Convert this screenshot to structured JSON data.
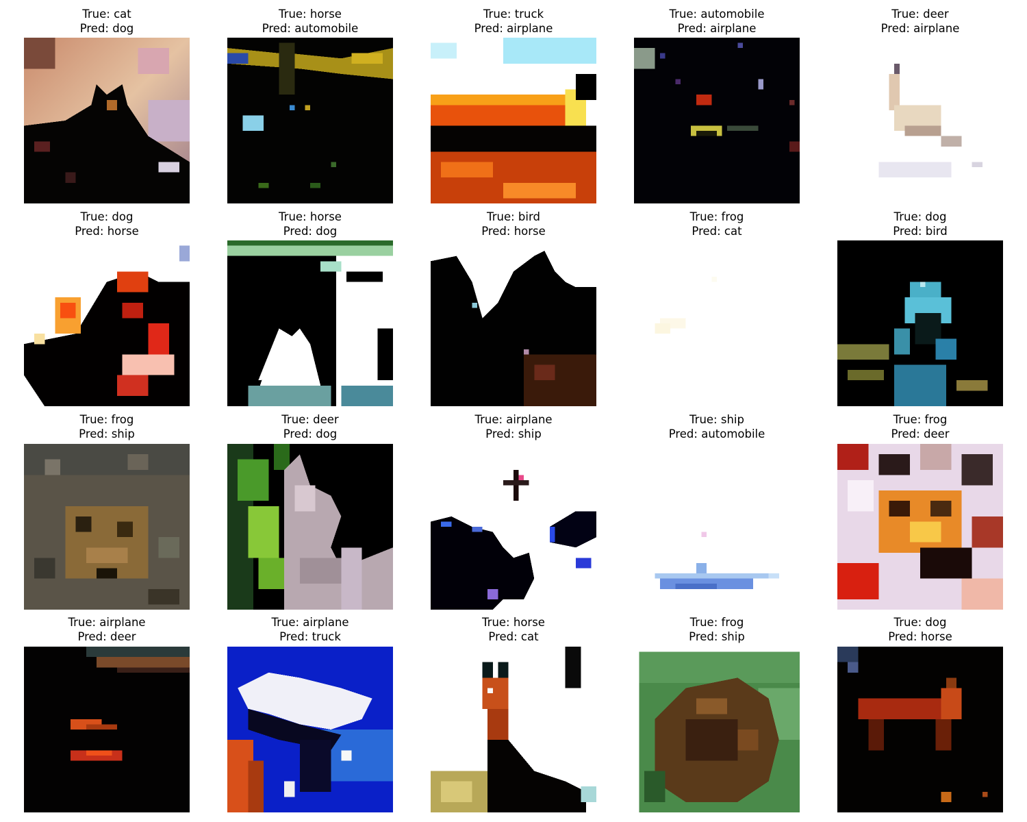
{
  "label_prefixes": {
    "true": "True: ",
    "pred": "Pred: "
  },
  "cells": [
    {
      "true": "cat",
      "pred": "dog",
      "picture": "dark cat silhouette against pink-brown textured background"
    },
    {
      "true": "horse",
      "pred": "automobile",
      "picture": "horse silhouette on dark background with yellow glare"
    },
    {
      "true": "truck",
      "pred": "airplane",
      "picture": "red-orange fire truck with sky at top"
    },
    {
      "true": "automobile",
      "pred": "airplane",
      "picture": "car at night, mostly dark with lights"
    },
    {
      "true": "deer",
      "pred": "airplane",
      "picture": "pale deer on white background"
    },
    {
      "true": "dog",
      "pred": "horse",
      "picture": "red and orange dog on white background"
    },
    {
      "true": "horse",
      "pred": "dog",
      "picture": "black and white high-contrast horse legs"
    },
    {
      "true": "bird",
      "pred": "horse",
      "picture": "dark bird silhouette on white background"
    },
    {
      "true": "frog",
      "pred": "cat",
      "picture": "nearly blank white image"
    },
    {
      "true": "dog",
      "pred": "bird",
      "picture": "blue-teal dog on black background"
    },
    {
      "true": "frog",
      "pred": "ship",
      "picture": "brown camouflaged frog on gray ground"
    },
    {
      "true": "deer",
      "pred": "dog",
      "picture": "white-gray deer with green foliage"
    },
    {
      "true": "airplane",
      "pred": "ship",
      "picture": "dark blobs on white background"
    },
    {
      "true": "ship",
      "pred": "automobile",
      "picture": "small blue ship on white background"
    },
    {
      "true": "frog",
      "pred": "deer",
      "picture": "orange frog with colorful noise"
    },
    {
      "true": "airplane",
      "pred": "deer",
      "picture": "dark sky with faint orange streaks"
    },
    {
      "true": "airplane",
      "pred": "truck",
      "picture": "white airplane against blue sky"
    },
    {
      "true": "horse",
      "pred": "cat",
      "picture": "brown horse head on white background"
    },
    {
      "true": "frog",
      "pred": "ship",
      "picture": "brown frog on green background"
    },
    {
      "true": "dog",
      "pred": "horse",
      "picture": "dark red dog on black background"
    }
  ]
}
